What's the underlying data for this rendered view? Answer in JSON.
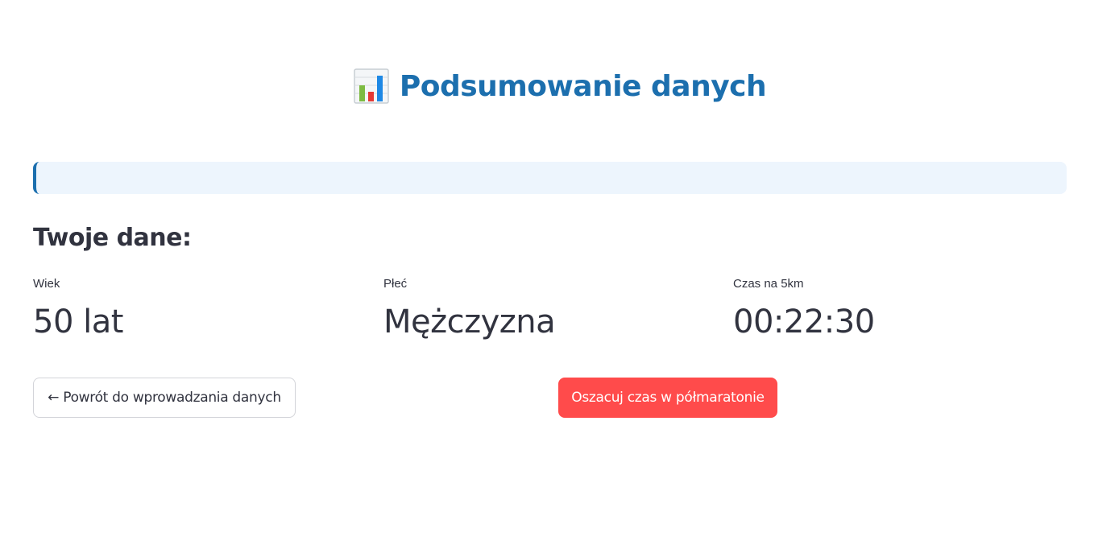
{
  "header": {
    "icon": "bar-chart-icon",
    "title": "Podsumowanie danych",
    "title_color": "#1c6fae"
  },
  "info_box": {
    "text": "",
    "background": "#edf5fd",
    "accent": "#1c6fae"
  },
  "summary": {
    "heading": "Twoje dane:",
    "metrics": [
      {
        "label": "Wiek",
        "value": "50 lat"
      },
      {
        "label": "Płeć",
        "value": "Mężczyzna"
      },
      {
        "label": "Czas na 5km",
        "value": "00:22:30"
      }
    ]
  },
  "actions": {
    "back_label": "← Powrót do wprowadzania danych",
    "estimate_label": "Oszacuj czas w półmaratonie",
    "primary_color": "#ff4b4b"
  }
}
